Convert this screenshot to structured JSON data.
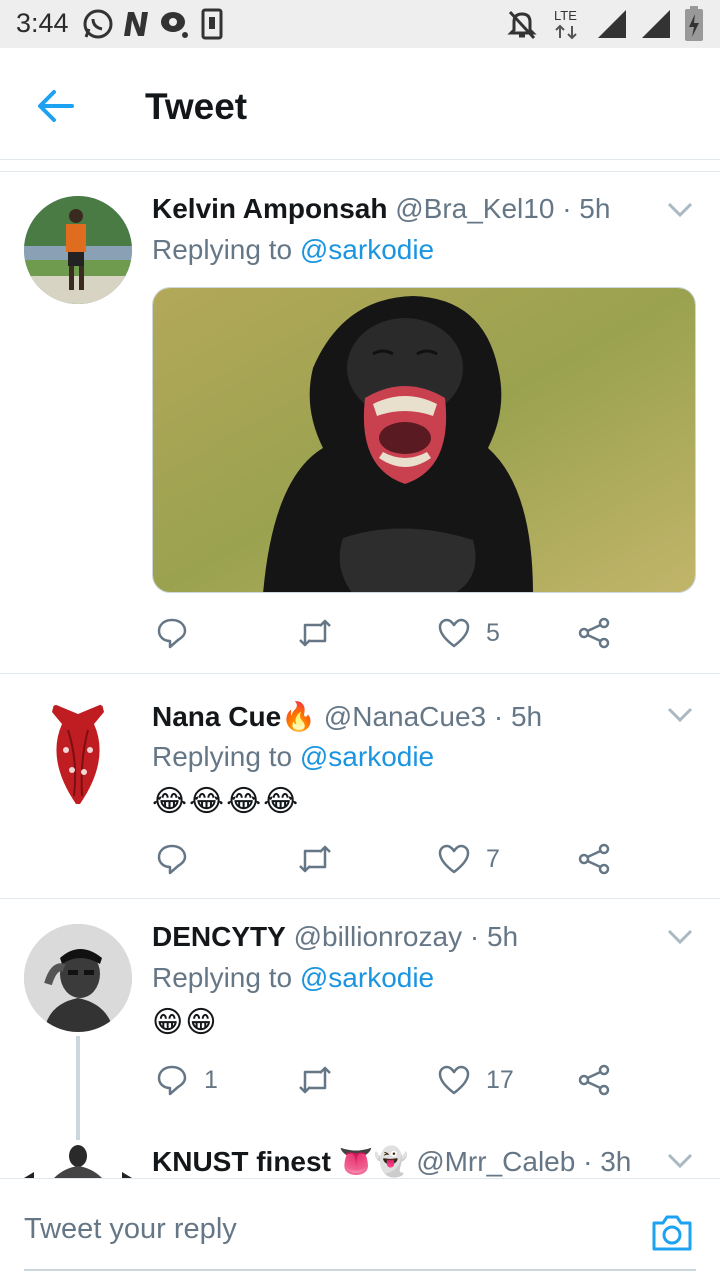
{
  "status_bar": {
    "time": "3:44",
    "network": "LTE",
    "icons": [
      "whatsapp-icon",
      "n-app-icon",
      "chat-icon",
      "phone-outline-icon",
      "mute-icon",
      "signal-icon",
      "signal-icon",
      "battery-icon"
    ]
  },
  "app_bar": {
    "title": "Tweet",
    "back_icon": "arrow-left-icon"
  },
  "colors": {
    "accent": "#1da1f2",
    "mention": "#1b95e0",
    "secondary_text": "#657786",
    "divider": "#e1e8ed"
  },
  "tweets": [
    {
      "name": "Kelvin Amponsah",
      "handle": "@Bra_Kel10 · 5h",
      "reply_prefix": "Replying to",
      "reply_to": "@sarkodie",
      "has_media": true,
      "reply_count": "",
      "like_count": "5"
    },
    {
      "name": "Nana Cue🔥",
      "handle": "@NanaCue3 · 5h",
      "reply_prefix": "Replying to",
      "reply_to": "@sarkodie",
      "text": "😂😂😂😂",
      "reply_count": "",
      "like_count": "7"
    },
    {
      "name": "DENCYTY",
      "handle": "@billionrozay · 5h",
      "reply_prefix": "Replying to",
      "reply_to": "@sarkodie",
      "text": "😁😁",
      "reply_count": "1",
      "like_count": "17"
    },
    {
      "name": "KNUST finest 👅👻",
      "handle": "@Mrr_Caleb · 3h"
    }
  ],
  "reply_bar": {
    "placeholder": "Tweet your reply",
    "camera_icon": "camera-icon"
  }
}
